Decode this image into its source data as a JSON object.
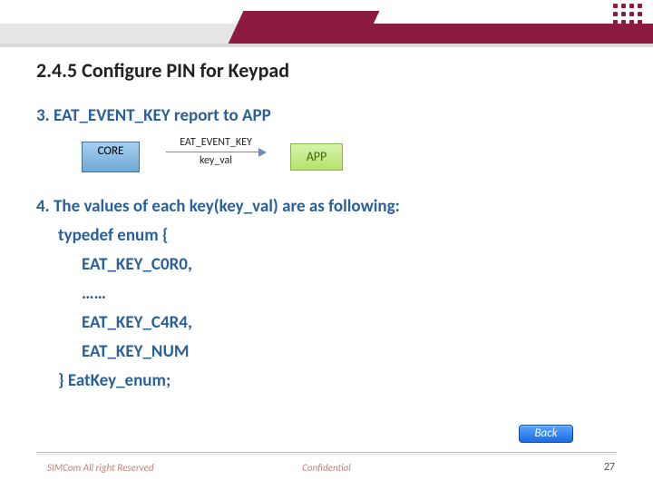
{
  "heading": "2.4.5 Configure PIN for Keypad",
  "step3": "3. EAT_EVENT_KEY report to APP",
  "diagram": {
    "core": "CORE",
    "label_top": "EAT_EVENT_KEY",
    "label_bottom": "key_val",
    "app": "APP"
  },
  "step4": "4. The values of each key(key_val) are as following:",
  "code": {
    "l1": "typedef enum {",
    "l2": "EAT_KEY_C0R0,",
    "l3": "……",
    "l4": "EAT_KEY_C4R4,",
    "l5": "EAT_KEY_NUM",
    "l6": "} EatKey_enum;"
  },
  "back": "Back",
  "footer": {
    "left": "SIMCom All right Reserved",
    "mid": "Confidential",
    "page": "27"
  }
}
